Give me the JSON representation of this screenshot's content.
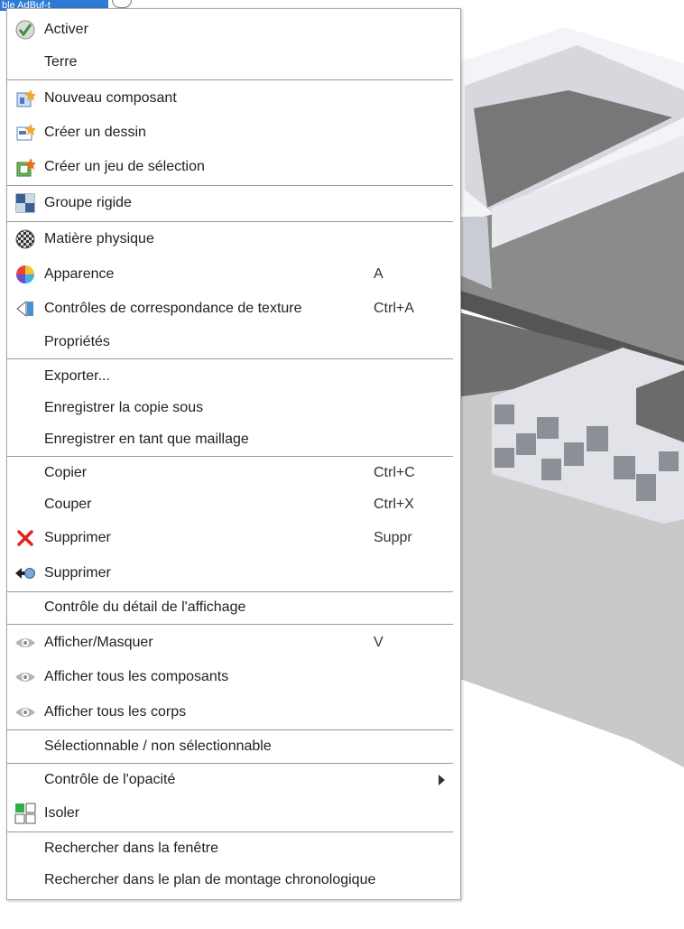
{
  "background": {
    "window_title_fragment": "ble AdBuf-t"
  },
  "menu": {
    "items": [
      {
        "id": "activer",
        "label": "Activer",
        "shortcut": "",
        "icon": "check-icon"
      },
      {
        "id": "terre",
        "label": "Terre",
        "shortcut": "",
        "icon": ""
      },
      {
        "id": "nouveau-composant",
        "label": "Nouveau composant",
        "shortcut": "",
        "icon": "new-component-icon"
      },
      {
        "id": "creer-dessin",
        "label": "Créer un dessin",
        "shortcut": "",
        "icon": "create-drawing-icon"
      },
      {
        "id": "creer-jeu-selection",
        "label": "Créer un jeu de sélection",
        "shortcut": "",
        "icon": "selection-set-icon"
      },
      {
        "id": "groupe-rigide",
        "label": "Groupe rigide",
        "shortcut": "",
        "icon": "rigid-group-icon"
      },
      {
        "id": "matiere-physique",
        "label": "Matière physique",
        "shortcut": "",
        "icon": "physical-material-icon"
      },
      {
        "id": "apparence",
        "label": "Apparence",
        "shortcut": "A",
        "icon": "appearance-icon"
      },
      {
        "id": "controles-texture",
        "label": "Contrôles de correspondance de texture",
        "shortcut": "Ctrl+A",
        "icon": "texture-map-icon"
      },
      {
        "id": "proprietes",
        "label": "Propriétés",
        "shortcut": "",
        "icon": ""
      },
      {
        "id": "exporter",
        "label": "Exporter...",
        "shortcut": "",
        "icon": ""
      },
      {
        "id": "enregistrer-copie",
        "label": "Enregistrer la copie sous",
        "shortcut": "",
        "icon": ""
      },
      {
        "id": "enregistrer-maillage",
        "label": "Enregistrer en tant que maillage",
        "shortcut": "",
        "icon": ""
      },
      {
        "id": "copier",
        "label": "Copier",
        "shortcut": "Ctrl+C",
        "icon": ""
      },
      {
        "id": "couper",
        "label": "Couper",
        "shortcut": "Ctrl+X",
        "icon": ""
      },
      {
        "id": "supprimer",
        "label": "Supprimer",
        "shortcut": "Suppr",
        "icon": "delete-x-icon"
      },
      {
        "id": "supprimer-2",
        "label": "Supprimer",
        "shortcut": "",
        "icon": "remove-arrow-icon"
      },
      {
        "id": "controle-detail",
        "label": "Contrôle du détail de l'affichage",
        "shortcut": "",
        "icon": ""
      },
      {
        "id": "afficher-masquer",
        "label": "Afficher/Masquer",
        "shortcut": "V",
        "icon": "eye-icon"
      },
      {
        "id": "afficher-composants",
        "label": "Afficher tous les composants",
        "shortcut": "",
        "icon": "eye-icon"
      },
      {
        "id": "afficher-corps",
        "label": "Afficher tous les corps",
        "shortcut": "",
        "icon": "eye-icon"
      },
      {
        "id": "selectionnable",
        "label": "Sélectionnable / non sélectionnable",
        "shortcut": "",
        "icon": ""
      },
      {
        "id": "controle-opacite",
        "label": "Contrôle de l'opacité",
        "shortcut": "",
        "icon": "",
        "submenu": true
      },
      {
        "id": "isoler",
        "label": "Isoler",
        "shortcut": "",
        "icon": "isolate-icon"
      },
      {
        "id": "rechercher-fenetre",
        "label": "Rechercher dans la fenêtre",
        "shortcut": "",
        "icon": ""
      },
      {
        "id": "rechercher-plan",
        "label": "Rechercher dans le plan de montage chronologique",
        "shortcut": "",
        "icon": ""
      }
    ]
  }
}
